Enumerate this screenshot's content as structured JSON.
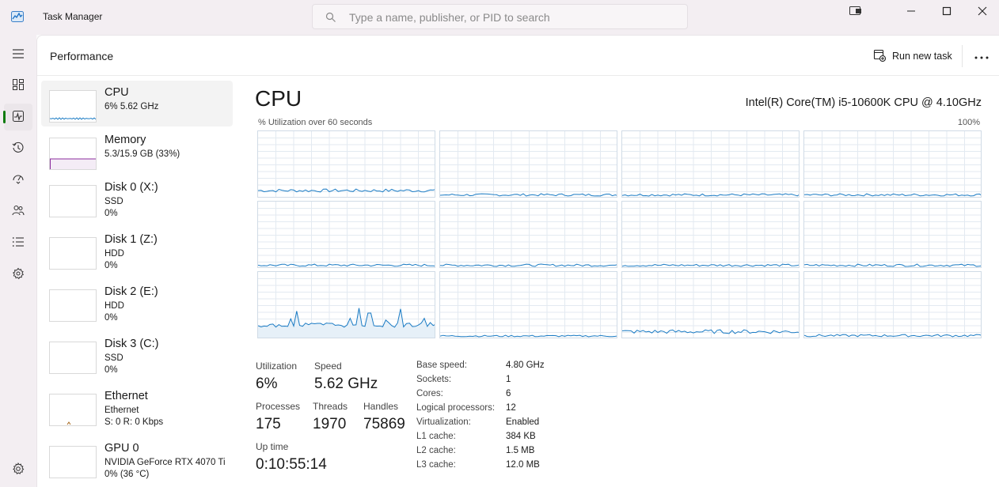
{
  "app": {
    "title": "Task Manager",
    "search_placeholder": "Type a name, publisher, or PID to search"
  },
  "rail": {
    "items": [
      {
        "name": "hamburger-menu-icon",
        "label": "Menu"
      },
      {
        "name": "processes-icon",
        "label": "Processes"
      },
      {
        "name": "performance-icon",
        "label": "Performance",
        "active": true
      },
      {
        "name": "app-history-icon",
        "label": "App history"
      },
      {
        "name": "startup-apps-icon",
        "label": "Startup apps"
      },
      {
        "name": "users-icon",
        "label": "Users"
      },
      {
        "name": "details-icon",
        "label": "Details"
      },
      {
        "name": "services-icon",
        "label": "Services"
      },
      {
        "name": "settings-icon",
        "label": "Settings"
      }
    ]
  },
  "header": {
    "title": "Performance",
    "run_new_task": "Run new task"
  },
  "resources": [
    {
      "name": "CPU",
      "line1": "6%  5.62 GHz",
      "line2": "",
      "color": "#1a7bc4"
    },
    {
      "name": "Memory",
      "line1": "5.3/15.9 GB (33%)",
      "line2": "",
      "color": "#8b2d9e"
    },
    {
      "name": "Disk 0 (X:)",
      "line1": "SSD",
      "line2": "0%",
      "color": "#4d9a2a"
    },
    {
      "name": "Disk 1 (Z:)",
      "line1": "HDD",
      "line2": "0%",
      "color": "#4d9a2a"
    },
    {
      "name": "Disk 2 (E:)",
      "line1": "HDD",
      "line2": "0%",
      "color": "#4d9a2a"
    },
    {
      "name": "Disk 3 (C:)",
      "line1": "SSD",
      "line2": "0%",
      "color": "#4d9a2a"
    },
    {
      "name": "Ethernet",
      "line1": "Ethernet",
      "line2": "S: 0  R: 0 Kbps",
      "color": "#a7681e"
    },
    {
      "name": "GPU 0",
      "line1": "NVIDIA GeForce RTX 4070 Ti",
      "line2": "0%  (36 °C)",
      "color": "#1a7bc4"
    }
  ],
  "cpu": {
    "title": "CPU",
    "model": "Intel(R) Core(TM) i5-10600K CPU @ 4.10GHz",
    "graph_label": "% Utilization over 60 seconds",
    "graph_max": "100%",
    "line_color": "#1a7bc4",
    "stats": {
      "utilization_label": "Utilization",
      "utilization": "6%",
      "speed_label": "Speed",
      "speed": "5.62 GHz",
      "processes_label": "Processes",
      "processes": "175",
      "threads_label": "Threads",
      "threads": "1970",
      "handles_label": "Handles",
      "handles": "75869",
      "uptime_label": "Up time",
      "uptime": "0:10:55:14"
    },
    "specs": [
      {
        "label": "Base speed:",
        "value": "4.80 GHz"
      },
      {
        "label": "Sockets:",
        "value": "1"
      },
      {
        "label": "Cores:",
        "value": "6"
      },
      {
        "label": "Logical processors:",
        "value": "12"
      },
      {
        "label": "Virtualization:",
        "value": "Enabled"
      },
      {
        "label": "L1 cache:",
        "value": "384 KB"
      },
      {
        "label": "L2 cache:",
        "value": "1.5 MB"
      },
      {
        "label": "L3 cache:",
        "value": "12.0 MB"
      }
    ]
  }
}
